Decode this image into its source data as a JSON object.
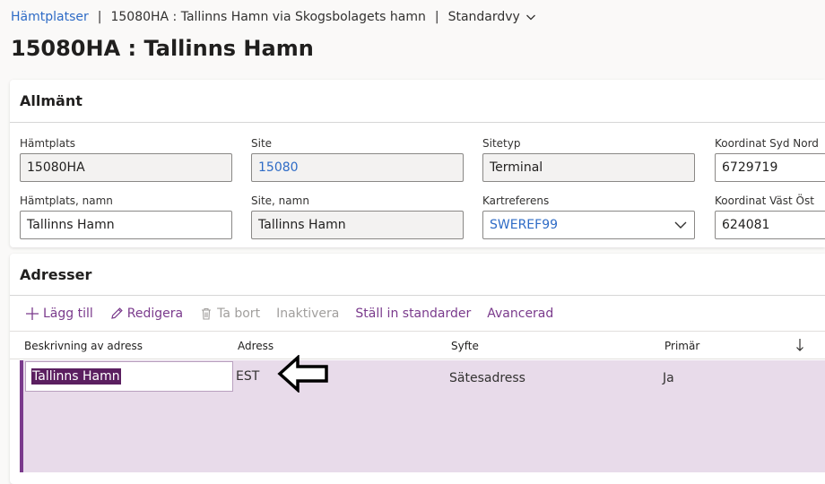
{
  "breadcrumb": {
    "link": "Hämtplatser",
    "current": "15080HA : Tallinns Hamn via Skogsbolagets hamn",
    "view": "Standardvy"
  },
  "page": {
    "title": "15080HA : Tallinns Hamn"
  },
  "general": {
    "header": "Allmänt",
    "fields": {
      "hamtplats": {
        "label": "Hämtplats",
        "value": "15080HA"
      },
      "site": {
        "label": "Site",
        "value": "15080"
      },
      "sitetyp": {
        "label": "Sitetyp",
        "value": "Terminal"
      },
      "koord_sn": {
        "label": "Koordinat Syd Nord",
        "value": "6729719"
      },
      "hamtplats_namn": {
        "label": "Hämtplats, namn",
        "value": "Tallinns Hamn"
      },
      "site_namn": {
        "label": "Site, namn",
        "value": "Tallinns Hamn"
      },
      "kartreferens": {
        "label": "Kartreferens",
        "value": "SWEREF99"
      },
      "koord_vo": {
        "label": "Koordinat Väst Öst",
        "value": "624081"
      }
    }
  },
  "addresses": {
    "header": "Adresser",
    "toolbar": {
      "add": "Lägg till",
      "edit": "Redigera",
      "delete": "Ta bort",
      "deactivate": "Inaktivera",
      "set_default": "Ställ in standarder",
      "advanced": "Avancerad"
    },
    "columns": [
      "Beskrivning av adress",
      "Adress",
      "Syfte",
      "Primär"
    ],
    "rows": [
      {
        "description": "Tallinns Hamn",
        "address": "EST",
        "purpose": "Sätesadress",
        "primary": "Ja"
      }
    ]
  },
  "colors": {
    "accent": "#7a3a8c",
    "link": "#2e6bc6",
    "row_selected": "#e8dbea"
  },
  "icons": [
    "chevron-down-icon",
    "add-icon",
    "edit-icon",
    "delete-icon",
    "sort-down-icon",
    "arrow-left-icon"
  ]
}
